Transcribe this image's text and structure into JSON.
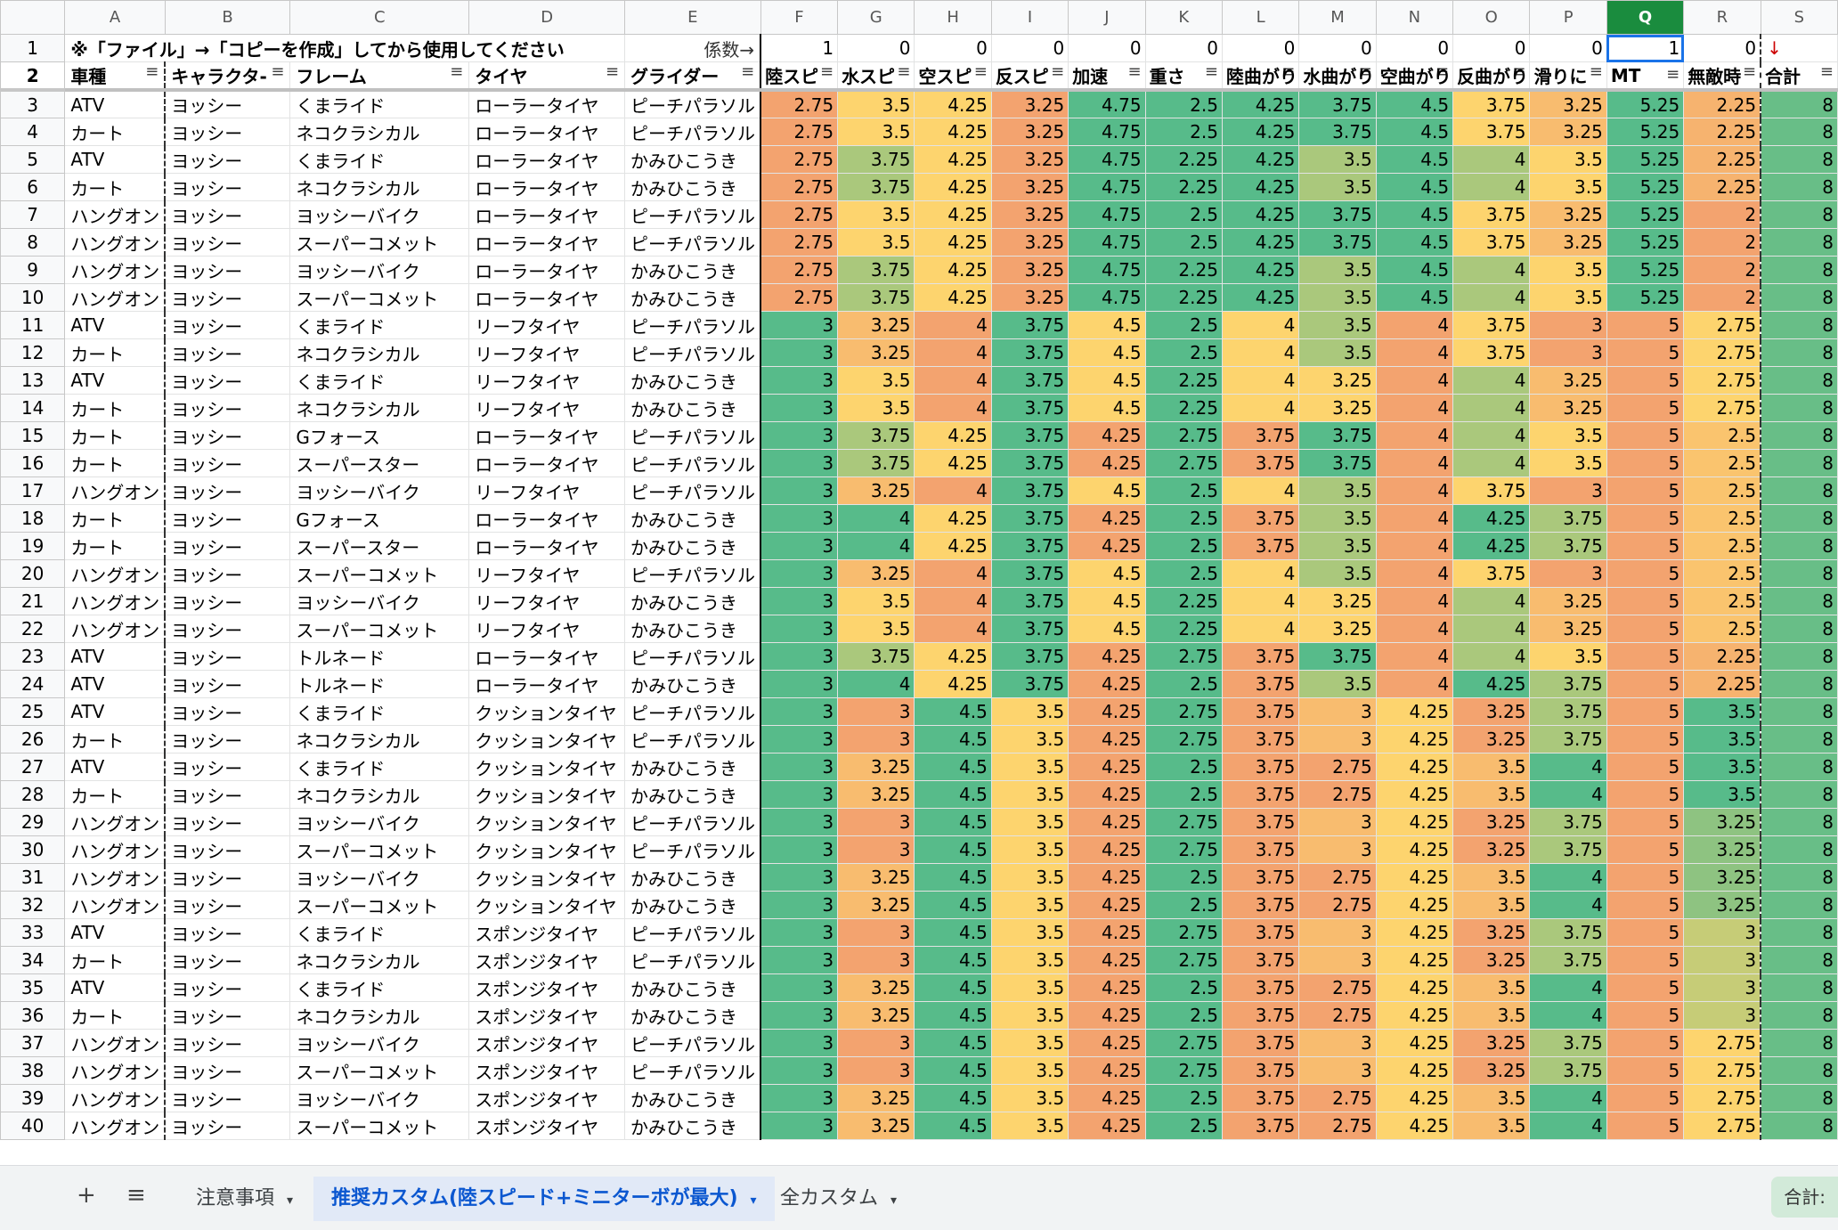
{
  "columns": [
    "A",
    "B",
    "C",
    "D",
    "E",
    "F",
    "G",
    "H",
    "I",
    "J",
    "K",
    "L",
    "M",
    "N",
    "O",
    "P",
    "Q",
    "R",
    "S"
  ],
  "selected_column": "Q",
  "row1": {
    "note": "※「ファイル」→「コピーを作成」してから使用してください",
    "coef_label": "係数→",
    "coefficients": [
      "1",
      "0",
      "0",
      "0",
      "0",
      "0",
      "0",
      "0",
      "0",
      "0",
      "0",
      "1",
      "0"
    ],
    "arrow": "↓"
  },
  "headers": [
    "車種",
    "キャラクタ-",
    "フレーム",
    "タイヤ",
    "グライダー",
    "陸スピ",
    "水スピ",
    "空スピ",
    "反スピ",
    "加速",
    "重さ",
    "陸曲がり",
    "水曲がり",
    "空曲がり",
    "反曲がり",
    "滑りに",
    "MT",
    "無敵時",
    "合計"
  ],
  "filter_icon": "≡",
  "rows": [
    [
      "ATV",
      "ヨッシー",
      "くまライド",
      "ローラータイヤ",
      "ピーチパラソル",
      "2.75",
      "3.5",
      "4.25",
      "3.25",
      "4.75",
      "2.5",
      "4.25",
      "3.75",
      "4.5",
      "3.75",
      "3.25",
      "5.25",
      "2.25",
      "8"
    ],
    [
      "カート",
      "ヨッシー",
      "ネコクラシカル",
      "ローラータイヤ",
      "ピーチパラソル",
      "2.75",
      "3.5",
      "4.25",
      "3.25",
      "4.75",
      "2.5",
      "4.25",
      "3.75",
      "4.5",
      "3.75",
      "3.25",
      "5.25",
      "2.25",
      "8"
    ],
    [
      "ATV",
      "ヨッシー",
      "くまライド",
      "ローラータイヤ",
      "かみひこうき",
      "2.75",
      "3.75",
      "4.25",
      "3.25",
      "4.75",
      "2.25",
      "4.25",
      "3.5",
      "4.5",
      "4",
      "3.5",
      "5.25",
      "2.25",
      "8"
    ],
    [
      "カート",
      "ヨッシー",
      "ネコクラシカル",
      "ローラータイヤ",
      "かみひこうき",
      "2.75",
      "3.75",
      "4.25",
      "3.25",
      "4.75",
      "2.25",
      "4.25",
      "3.5",
      "4.5",
      "4",
      "3.5",
      "5.25",
      "2.25",
      "8"
    ],
    [
      "ハングオン",
      "ヨッシー",
      "ヨッシーバイク",
      "ローラータイヤ",
      "ピーチパラソル",
      "2.75",
      "3.5",
      "4.25",
      "3.25",
      "4.75",
      "2.5",
      "4.25",
      "3.75",
      "4.5",
      "3.75",
      "3.25",
      "5.25",
      "2",
      "8"
    ],
    [
      "ハングオン",
      "ヨッシー",
      "スーパーコメット",
      "ローラータイヤ",
      "ピーチパラソル",
      "2.75",
      "3.5",
      "4.25",
      "3.25",
      "4.75",
      "2.5",
      "4.25",
      "3.75",
      "4.5",
      "3.75",
      "3.25",
      "5.25",
      "2",
      "8"
    ],
    [
      "ハングオン",
      "ヨッシー",
      "ヨッシーバイク",
      "ローラータイヤ",
      "かみひこうき",
      "2.75",
      "3.75",
      "4.25",
      "3.25",
      "4.75",
      "2.25",
      "4.25",
      "3.5",
      "4.5",
      "4",
      "3.5",
      "5.25",
      "2",
      "8"
    ],
    [
      "ハングオン",
      "ヨッシー",
      "スーパーコメット",
      "ローラータイヤ",
      "かみひこうき",
      "2.75",
      "3.75",
      "4.25",
      "3.25",
      "4.75",
      "2.25",
      "4.25",
      "3.5",
      "4.5",
      "4",
      "3.5",
      "5.25",
      "2",
      "8"
    ],
    [
      "ATV",
      "ヨッシー",
      "くまライド",
      "リーフタイヤ",
      "ピーチパラソル",
      "3",
      "3.25",
      "4",
      "3.75",
      "4.5",
      "2.5",
      "4",
      "3.5",
      "4",
      "3.75",
      "3",
      "5",
      "2.75",
      "8"
    ],
    [
      "カート",
      "ヨッシー",
      "ネコクラシカル",
      "リーフタイヤ",
      "ピーチパラソル",
      "3",
      "3.25",
      "4",
      "3.75",
      "4.5",
      "2.5",
      "4",
      "3.5",
      "4",
      "3.75",
      "3",
      "5",
      "2.75",
      "8"
    ],
    [
      "ATV",
      "ヨッシー",
      "くまライド",
      "リーフタイヤ",
      "かみひこうき",
      "3",
      "3.5",
      "4",
      "3.75",
      "4.5",
      "2.25",
      "4",
      "3.25",
      "4",
      "4",
      "3.25",
      "5",
      "2.75",
      "8"
    ],
    [
      "カート",
      "ヨッシー",
      "ネコクラシカル",
      "リーフタイヤ",
      "かみひこうき",
      "3",
      "3.5",
      "4",
      "3.75",
      "4.5",
      "2.25",
      "4",
      "3.25",
      "4",
      "4",
      "3.25",
      "5",
      "2.75",
      "8"
    ],
    [
      "カート",
      "ヨッシー",
      "Gフォース",
      "ローラータイヤ",
      "ピーチパラソル",
      "3",
      "3.75",
      "4.25",
      "3.75",
      "4.25",
      "2.75",
      "3.75",
      "3.75",
      "4",
      "4",
      "3.5",
      "5",
      "2.5",
      "8"
    ],
    [
      "カート",
      "ヨッシー",
      "スーパースター",
      "ローラータイヤ",
      "ピーチパラソル",
      "3",
      "3.75",
      "4.25",
      "3.75",
      "4.25",
      "2.75",
      "3.75",
      "3.75",
      "4",
      "4",
      "3.5",
      "5",
      "2.5",
      "8"
    ],
    [
      "ハングオン",
      "ヨッシー",
      "ヨッシーバイク",
      "リーフタイヤ",
      "ピーチパラソル",
      "3",
      "3.25",
      "4",
      "3.75",
      "4.5",
      "2.5",
      "4",
      "3.5",
      "4",
      "3.75",
      "3",
      "5",
      "2.5",
      "8"
    ],
    [
      "カート",
      "ヨッシー",
      "Gフォース",
      "ローラータイヤ",
      "かみひこうき",
      "3",
      "4",
      "4.25",
      "3.75",
      "4.25",
      "2.5",
      "3.75",
      "3.5",
      "4",
      "4.25",
      "3.75",
      "5",
      "2.5",
      "8"
    ],
    [
      "カート",
      "ヨッシー",
      "スーパースター",
      "ローラータイヤ",
      "かみひこうき",
      "3",
      "4",
      "4.25",
      "3.75",
      "4.25",
      "2.5",
      "3.75",
      "3.5",
      "4",
      "4.25",
      "3.75",
      "5",
      "2.5",
      "8"
    ],
    [
      "ハングオン",
      "ヨッシー",
      "スーパーコメット",
      "リーフタイヤ",
      "ピーチパラソル",
      "3",
      "3.25",
      "4",
      "3.75",
      "4.5",
      "2.5",
      "4",
      "3.5",
      "4",
      "3.75",
      "3",
      "5",
      "2.5",
      "8"
    ],
    [
      "ハングオン",
      "ヨッシー",
      "ヨッシーバイク",
      "リーフタイヤ",
      "かみひこうき",
      "3",
      "3.5",
      "4",
      "3.75",
      "4.5",
      "2.25",
      "4",
      "3.25",
      "4",
      "4",
      "3.25",
      "5",
      "2.5",
      "8"
    ],
    [
      "ハングオン",
      "ヨッシー",
      "スーパーコメット",
      "リーフタイヤ",
      "かみひこうき",
      "3",
      "3.5",
      "4",
      "3.75",
      "4.5",
      "2.25",
      "4",
      "3.25",
      "4",
      "4",
      "3.25",
      "5",
      "2.5",
      "8"
    ],
    [
      "ATV",
      "ヨッシー",
      "トルネード",
      "ローラータイヤ",
      "ピーチパラソル",
      "3",
      "3.75",
      "4.25",
      "3.75",
      "4.25",
      "2.75",
      "3.75",
      "3.75",
      "4",
      "4",
      "3.5",
      "5",
      "2.25",
      "8"
    ],
    [
      "ATV",
      "ヨッシー",
      "トルネード",
      "ローラータイヤ",
      "かみひこうき",
      "3",
      "4",
      "4.25",
      "3.75",
      "4.25",
      "2.5",
      "3.75",
      "3.5",
      "4",
      "4.25",
      "3.75",
      "5",
      "2.25",
      "8"
    ],
    [
      "ATV",
      "ヨッシー",
      "くまライド",
      "クッションタイヤ",
      "ピーチパラソル",
      "3",
      "3",
      "4.5",
      "3.5",
      "4.25",
      "2.75",
      "3.75",
      "3",
      "4.25",
      "3.25",
      "3.75",
      "5",
      "3.5",
      "8"
    ],
    [
      "カート",
      "ヨッシー",
      "ネコクラシカル",
      "クッションタイヤ",
      "ピーチパラソル",
      "3",
      "3",
      "4.5",
      "3.5",
      "4.25",
      "2.75",
      "3.75",
      "3",
      "4.25",
      "3.25",
      "3.75",
      "5",
      "3.5",
      "8"
    ],
    [
      "ATV",
      "ヨッシー",
      "くまライド",
      "クッションタイヤ",
      "かみひこうき",
      "3",
      "3.25",
      "4.5",
      "3.5",
      "4.25",
      "2.5",
      "3.75",
      "2.75",
      "4.25",
      "3.5",
      "4",
      "5",
      "3.5",
      "8"
    ],
    [
      "カート",
      "ヨッシー",
      "ネコクラシカル",
      "クッションタイヤ",
      "かみひこうき",
      "3",
      "3.25",
      "4.5",
      "3.5",
      "4.25",
      "2.5",
      "3.75",
      "2.75",
      "4.25",
      "3.5",
      "4",
      "5",
      "3.5",
      "8"
    ],
    [
      "ハングオン",
      "ヨッシー",
      "ヨッシーバイク",
      "クッションタイヤ",
      "ピーチパラソル",
      "3",
      "3",
      "4.5",
      "3.5",
      "4.25",
      "2.75",
      "3.75",
      "3",
      "4.25",
      "3.25",
      "3.75",
      "5",
      "3.25",
      "8"
    ],
    [
      "ハングオン",
      "ヨッシー",
      "スーパーコメット",
      "クッションタイヤ",
      "ピーチパラソル",
      "3",
      "3",
      "4.5",
      "3.5",
      "4.25",
      "2.75",
      "3.75",
      "3",
      "4.25",
      "3.25",
      "3.75",
      "5",
      "3.25",
      "8"
    ],
    [
      "ハングオン",
      "ヨッシー",
      "ヨッシーバイク",
      "クッションタイヤ",
      "かみひこうき",
      "3",
      "3.25",
      "4.5",
      "3.5",
      "4.25",
      "2.5",
      "3.75",
      "2.75",
      "4.25",
      "3.5",
      "4",
      "5",
      "3.25",
      "8"
    ],
    [
      "ハングオン",
      "ヨッシー",
      "スーパーコメット",
      "クッションタイヤ",
      "かみひこうき",
      "3",
      "3.25",
      "4.5",
      "3.5",
      "4.25",
      "2.5",
      "3.75",
      "2.75",
      "4.25",
      "3.5",
      "4",
      "5",
      "3.25",
      "8"
    ],
    [
      "ATV",
      "ヨッシー",
      "くまライド",
      "スポンジタイヤ",
      "ピーチパラソル",
      "3",
      "3",
      "4.5",
      "3.5",
      "4.25",
      "2.75",
      "3.75",
      "3",
      "4.25",
      "3.25",
      "3.75",
      "5",
      "3",
      "8"
    ],
    [
      "カート",
      "ヨッシー",
      "ネコクラシカル",
      "スポンジタイヤ",
      "ピーチパラソル",
      "3",
      "3",
      "4.5",
      "3.5",
      "4.25",
      "2.75",
      "3.75",
      "3",
      "4.25",
      "3.25",
      "3.75",
      "5",
      "3",
      "8"
    ],
    [
      "ATV",
      "ヨッシー",
      "くまライド",
      "スポンジタイヤ",
      "かみひこうき",
      "3",
      "3.25",
      "4.5",
      "3.5",
      "4.25",
      "2.5",
      "3.75",
      "2.75",
      "4.25",
      "3.5",
      "4",
      "5",
      "3",
      "8"
    ],
    [
      "カート",
      "ヨッシー",
      "ネコクラシカル",
      "スポンジタイヤ",
      "かみひこうき",
      "3",
      "3.25",
      "4.5",
      "3.5",
      "4.25",
      "2.5",
      "3.75",
      "2.75",
      "4.25",
      "3.5",
      "4",
      "5",
      "3",
      "8"
    ],
    [
      "ハングオン",
      "ヨッシー",
      "ヨッシーバイク",
      "スポンジタイヤ",
      "ピーチパラソル",
      "3",
      "3",
      "4.5",
      "3.5",
      "4.25",
      "2.75",
      "3.75",
      "3",
      "4.25",
      "3.25",
      "3.75",
      "5",
      "2.75",
      "8"
    ],
    [
      "ハングオン",
      "ヨッシー",
      "スーパーコメット",
      "スポンジタイヤ",
      "ピーチパラソル",
      "3",
      "3",
      "4.5",
      "3.5",
      "4.25",
      "2.75",
      "3.75",
      "3",
      "4.25",
      "3.25",
      "3.75",
      "5",
      "2.75",
      "8"
    ],
    [
      "ハングオン",
      "ヨッシー",
      "ヨッシーバイク",
      "スポンジタイヤ",
      "かみひこうき",
      "3",
      "3.25",
      "4.5",
      "3.5",
      "4.25",
      "2.5",
      "3.75",
      "2.75",
      "4.25",
      "3.5",
      "4",
      "5",
      "2.75",
      "8"
    ],
    [
      "ハングオン",
      "ヨッシー",
      "スーパーコメット",
      "スポンジタイヤ",
      "かみひこうき",
      "3",
      "3.25",
      "4.5",
      "3.5",
      "4.25",
      "2.5",
      "3.75",
      "2.75",
      "4.25",
      "3.5",
      "4",
      "5",
      "2.75",
      "8"
    ]
  ],
  "heat_colors": {
    "low": "#f3a36f",
    "mid": "#fdd46e",
    "high": "#57bb8a"
  },
  "tabs": [
    {
      "label": "注意事項",
      "active": false
    },
    {
      "label": "推奨カスタム(陸スピード+ミニターボが最大)",
      "active": true
    },
    {
      "label": "全カスタム",
      "active": false
    }
  ],
  "tabbar": {
    "add_icon": "+",
    "menu_icon": "≡",
    "caret": "▾",
    "sum_label": "合計:"
  }
}
